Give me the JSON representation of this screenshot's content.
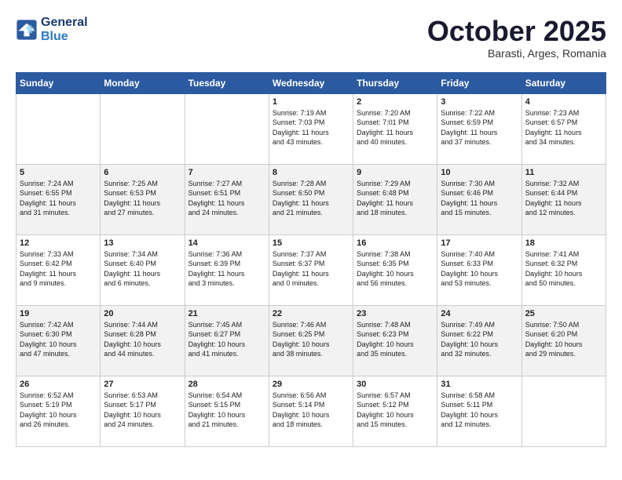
{
  "header": {
    "logo_line1": "General",
    "logo_line2": "Blue",
    "month": "October 2025",
    "location": "Barasti, Arges, Romania"
  },
  "weekdays": [
    "Sunday",
    "Monday",
    "Tuesday",
    "Wednesday",
    "Thursday",
    "Friday",
    "Saturday"
  ],
  "weeks": [
    [
      {
        "day": "",
        "info": ""
      },
      {
        "day": "",
        "info": ""
      },
      {
        "day": "",
        "info": ""
      },
      {
        "day": "1",
        "info": "Sunrise: 7:19 AM\nSunset: 7:03 PM\nDaylight: 11 hours\nand 43 minutes."
      },
      {
        "day": "2",
        "info": "Sunrise: 7:20 AM\nSunset: 7:01 PM\nDaylight: 11 hours\nand 40 minutes."
      },
      {
        "day": "3",
        "info": "Sunrise: 7:22 AM\nSunset: 6:59 PM\nDaylight: 11 hours\nand 37 minutes."
      },
      {
        "day": "4",
        "info": "Sunrise: 7:23 AM\nSunset: 6:57 PM\nDaylight: 11 hours\nand 34 minutes."
      }
    ],
    [
      {
        "day": "5",
        "info": "Sunrise: 7:24 AM\nSunset: 6:55 PM\nDaylight: 11 hours\nand 31 minutes."
      },
      {
        "day": "6",
        "info": "Sunrise: 7:25 AM\nSunset: 6:53 PM\nDaylight: 11 hours\nand 27 minutes."
      },
      {
        "day": "7",
        "info": "Sunrise: 7:27 AM\nSunset: 6:51 PM\nDaylight: 11 hours\nand 24 minutes."
      },
      {
        "day": "8",
        "info": "Sunrise: 7:28 AM\nSunset: 6:50 PM\nDaylight: 11 hours\nand 21 minutes."
      },
      {
        "day": "9",
        "info": "Sunrise: 7:29 AM\nSunset: 6:48 PM\nDaylight: 11 hours\nand 18 minutes."
      },
      {
        "day": "10",
        "info": "Sunrise: 7:30 AM\nSunset: 6:46 PM\nDaylight: 11 hours\nand 15 minutes."
      },
      {
        "day": "11",
        "info": "Sunrise: 7:32 AM\nSunset: 6:44 PM\nDaylight: 11 hours\nand 12 minutes."
      }
    ],
    [
      {
        "day": "12",
        "info": "Sunrise: 7:33 AM\nSunset: 6:42 PM\nDaylight: 11 hours\nand 9 minutes."
      },
      {
        "day": "13",
        "info": "Sunrise: 7:34 AM\nSunset: 6:40 PM\nDaylight: 11 hours\nand 6 minutes."
      },
      {
        "day": "14",
        "info": "Sunrise: 7:36 AM\nSunset: 6:39 PM\nDaylight: 11 hours\nand 3 minutes."
      },
      {
        "day": "15",
        "info": "Sunrise: 7:37 AM\nSunset: 6:37 PM\nDaylight: 11 hours\nand 0 minutes."
      },
      {
        "day": "16",
        "info": "Sunrise: 7:38 AM\nSunset: 6:35 PM\nDaylight: 10 hours\nand 56 minutes."
      },
      {
        "day": "17",
        "info": "Sunrise: 7:40 AM\nSunset: 6:33 PM\nDaylight: 10 hours\nand 53 minutes."
      },
      {
        "day": "18",
        "info": "Sunrise: 7:41 AM\nSunset: 6:32 PM\nDaylight: 10 hours\nand 50 minutes."
      }
    ],
    [
      {
        "day": "19",
        "info": "Sunrise: 7:42 AM\nSunset: 6:30 PM\nDaylight: 10 hours\nand 47 minutes."
      },
      {
        "day": "20",
        "info": "Sunrise: 7:44 AM\nSunset: 6:28 PM\nDaylight: 10 hours\nand 44 minutes."
      },
      {
        "day": "21",
        "info": "Sunrise: 7:45 AM\nSunset: 6:27 PM\nDaylight: 10 hours\nand 41 minutes."
      },
      {
        "day": "22",
        "info": "Sunrise: 7:46 AM\nSunset: 6:25 PM\nDaylight: 10 hours\nand 38 minutes."
      },
      {
        "day": "23",
        "info": "Sunrise: 7:48 AM\nSunset: 6:23 PM\nDaylight: 10 hours\nand 35 minutes."
      },
      {
        "day": "24",
        "info": "Sunrise: 7:49 AM\nSunset: 6:22 PM\nDaylight: 10 hours\nand 32 minutes."
      },
      {
        "day": "25",
        "info": "Sunrise: 7:50 AM\nSunset: 6:20 PM\nDaylight: 10 hours\nand 29 minutes."
      }
    ],
    [
      {
        "day": "26",
        "info": "Sunrise: 6:52 AM\nSunset: 5:19 PM\nDaylight: 10 hours\nand 26 minutes."
      },
      {
        "day": "27",
        "info": "Sunrise: 6:53 AM\nSunset: 5:17 PM\nDaylight: 10 hours\nand 24 minutes."
      },
      {
        "day": "28",
        "info": "Sunrise: 6:54 AM\nSunset: 5:15 PM\nDaylight: 10 hours\nand 21 minutes."
      },
      {
        "day": "29",
        "info": "Sunrise: 6:56 AM\nSunset: 5:14 PM\nDaylight: 10 hours\nand 18 minutes."
      },
      {
        "day": "30",
        "info": "Sunrise: 6:57 AM\nSunset: 5:12 PM\nDaylight: 10 hours\nand 15 minutes."
      },
      {
        "day": "31",
        "info": "Sunrise: 6:58 AM\nSunset: 5:11 PM\nDaylight: 10 hours\nand 12 minutes."
      },
      {
        "day": "",
        "info": ""
      }
    ]
  ]
}
